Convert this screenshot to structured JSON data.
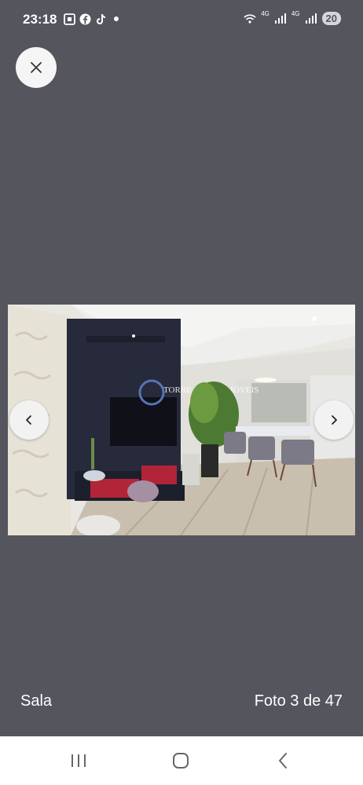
{
  "status_bar": {
    "time": "23:18",
    "network_1": "4G",
    "network_2": "4G",
    "battery": "20"
  },
  "viewer": {
    "caption": "Sala",
    "counter": "Foto 3 de 47",
    "watermark": "TORRE FORTE IMÓVEIS"
  },
  "icons": {
    "close": "close-icon",
    "prev": "chevron-left-icon",
    "next": "chevron-right-icon"
  },
  "colors": {
    "background": "#55555e",
    "navbar": "#ffffff"
  }
}
